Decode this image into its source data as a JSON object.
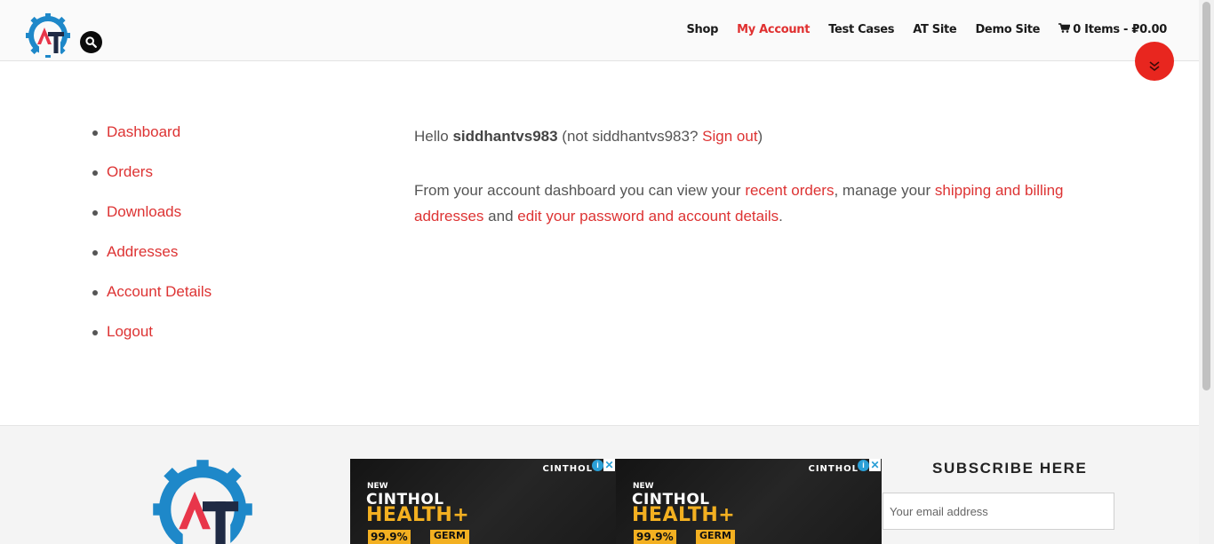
{
  "header": {
    "nav": [
      {
        "label": "Shop",
        "active": false
      },
      {
        "label": "My Account",
        "active": true
      },
      {
        "label": "Test Cases",
        "active": false
      },
      {
        "label": "AT Site",
        "active": false
      },
      {
        "label": "Demo Site",
        "active": false
      }
    ],
    "cart_label": "0 Items - ₽0.00"
  },
  "account_nav": [
    "Dashboard",
    "Orders",
    "Downloads",
    "Addresses",
    "Account Details",
    "Logout"
  ],
  "content": {
    "hello": "Hello ",
    "username": "siddhantvs983",
    "not_prefix": " (not ",
    "not_user": "siddhantvs983? ",
    "sign_out": "Sign out",
    "close_paren": ")",
    "dash_intro": "From your account dashboard you can view your ",
    "recent_orders": "recent orders",
    "manage": ", manage your ",
    "shipping_billing": "shipping and billing addresses",
    "and": " and ",
    "edit_password": "edit your password and account details",
    "period": "."
  },
  "footer": {
    "subscribe_title": "SUBSCRIBE HERE",
    "email_placeholder": "Your email address",
    "ads": [
      {
        "brand": "CINTHOL",
        "new": "NEW",
        "line1": "CINTHOL",
        "line2": "HEALTH+",
        "pct": "99.9%",
        "germ": "GERM"
      },
      {
        "brand": "CINTHOL",
        "new": "NEW",
        "line1": "CINTHOL",
        "line2": "HEALTH+",
        "pct": "99.9%",
        "germ": "GERM"
      }
    ]
  },
  "colors": {
    "accent": "#dd3333",
    "nav_active": "#e03030",
    "scroll_button": "#e8261f",
    "ad_yellow": "#f3b021"
  },
  "icons": [
    "logo",
    "search-icon",
    "cart-icon",
    "chevron-double-down-icon",
    "ad-info-icon",
    "ad-close-icon"
  ]
}
